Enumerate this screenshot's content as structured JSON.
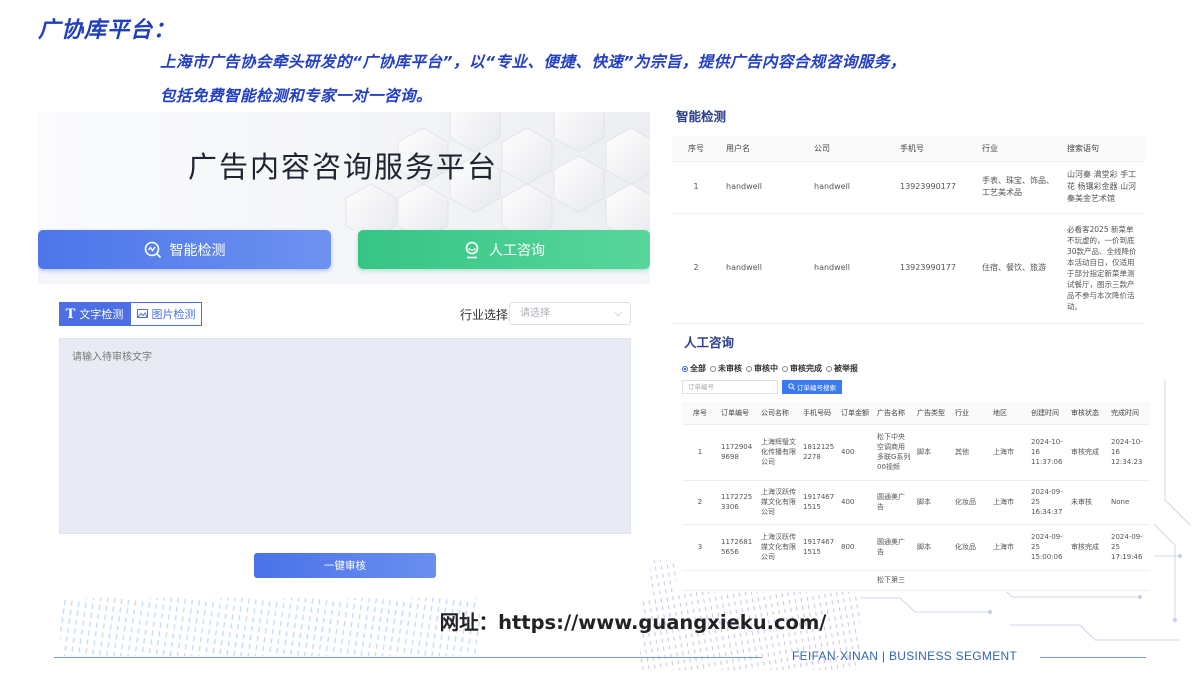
{
  "slide": {
    "title": "广协库平台：",
    "intro_line1": "上海市广告协会牵头研发的“广协库平台”，以“专业、便捷、快速”为宗旨，提供广告内容合规咨询服务，",
    "intro_line2": "包括免费智能检测和专家一对一咨询。",
    "website": "网址：https://www.guangxieku.com/",
    "footer": "FEIFAN·XINAN | BUSINESS SEGMENT",
    "colors": {
      "title": "#1f3fbf",
      "accent_blue": "#4c6fe6",
      "accent_green": "#36c485",
      "footer": "#2f68b8"
    }
  },
  "platform": {
    "hero_title": "广告内容咨询服务平台",
    "smart_button": "智能检测",
    "human_button": "人工咨询",
    "tab_text": "文字检测",
    "tab_image": "图片检测",
    "industry_label": "行业选择",
    "industry_placeholder": "请选择",
    "textarea_placeholder": "请输入待审核文字",
    "audit_button": "一键审核",
    "icons": {
      "smart": "search-chart-icon",
      "human": "user-icon",
      "text": "text-t-icon",
      "image": "image-icon",
      "dropdown": "chevron-down-icon"
    }
  },
  "smart_table": {
    "title": "智能检测",
    "headers": [
      "序号",
      "用户名",
      "公司",
      "手机号",
      "行业",
      "搜索语句"
    ],
    "rows": [
      [
        "1",
        "handwell",
        "handwell",
        "13923990177",
        "手表、珠宝、饰品、工艺美术品",
        "山河秦 满堂彩 手工花 杨镶彩金器 山河秦美金艺术馆"
      ],
      [
        "2",
        "handwell",
        "handwell",
        "13923990177",
        "住宿、餐饮、旅游",
        "必看客2025 新菜单不玩虚的，一价到底 30款产品、全线降价 本活动自日，仅适用于部分指定新菜单测试餐厅，图示三款产品不参与本次降价活动。"
      ]
    ]
  },
  "human_table": {
    "title": "人工咨询",
    "filters": [
      "全部",
      "未审核",
      "审核中",
      "审核完成",
      "被举报"
    ],
    "order_placeholder": "订单编号",
    "search_button": "订单编号搜索",
    "headers": [
      "序号",
      "订单编号",
      "公司名称",
      "手机号码",
      "订单金额",
      "广告名称",
      "广告类型",
      "行业",
      "地区",
      "创建时间",
      "审核状态",
      "完成时间"
    ],
    "rows": [
      [
        "1",
        "11729049698",
        "上海辉璧文化传播有限公司",
        "18121252278",
        "400",
        "松下中央空调商用多联G系列00视频",
        "脚本",
        "其他",
        "上海市",
        "2024-10-16 11:37:06",
        "审核完成",
        "2024-10-16 12:34:23"
      ],
      [
        "2",
        "11727253306",
        "上海汉跃传媒文化有限公司",
        "19174671515",
        "400",
        "圆通美广告",
        "脚本",
        "化妆品",
        "上海市",
        "2024-09-25 16:34:37",
        "未审核",
        "None"
      ],
      [
        "3",
        "11726815656",
        "上海汉跃传媒文化有限公司",
        "19174671515",
        "800",
        "圆通美广告",
        "脚本",
        "化妆品",
        "上海市",
        "2024-09-25 15:00:06",
        "审核完成",
        "2024-09-25 17:19:46"
      ],
      [
        "",
        "",
        "",
        "",
        "",
        "松下第三",
        "",
        "",
        "",
        "",
        "",
        ""
      ]
    ]
  }
}
